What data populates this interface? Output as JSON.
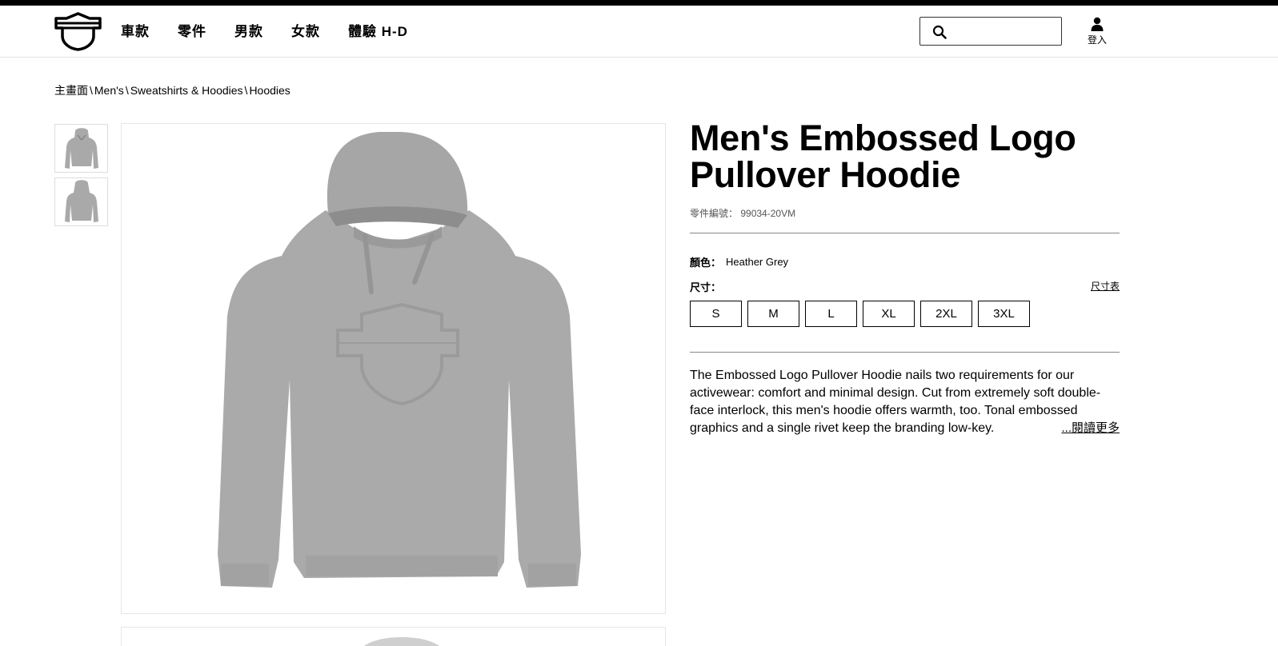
{
  "nav": {
    "items": [
      "車款",
      "零件",
      "男款",
      "女款",
      "體驗 H-D"
    ]
  },
  "search": {
    "placeholder": ""
  },
  "account": {
    "login_label": "登入"
  },
  "breadcrumb": [
    "主畫面",
    "Men's",
    "Sweatshirts & Hoodies",
    "Hoodies"
  ],
  "breadcrumb_separator": "\\",
  "product": {
    "title": "Men's Embossed Logo Pullover Hoodie",
    "part_label": "零件編號：",
    "part_number": "99034-20VM",
    "color_label": "顏色：",
    "color_value": "Heather Grey",
    "size_label": "尺寸：",
    "size_chart_label": "尺寸表",
    "sizes": [
      "S",
      "M",
      "L",
      "XL",
      "2XL",
      "3XL"
    ],
    "description": "The Embossed Logo Pullover Hoodie nails two requirements for our activewear: comfort and minimal design. Cut from extremely soft double-face interlock, this men's hoodie offers warmth, too. Tonal embossed graphics and a single rivet keep the branding low-key.",
    "read_more_label": "...閱讀更多"
  },
  "colors": {
    "accent": "#000000",
    "hoodie": "#a9a9a9",
    "border": "#e6e6e6"
  }
}
